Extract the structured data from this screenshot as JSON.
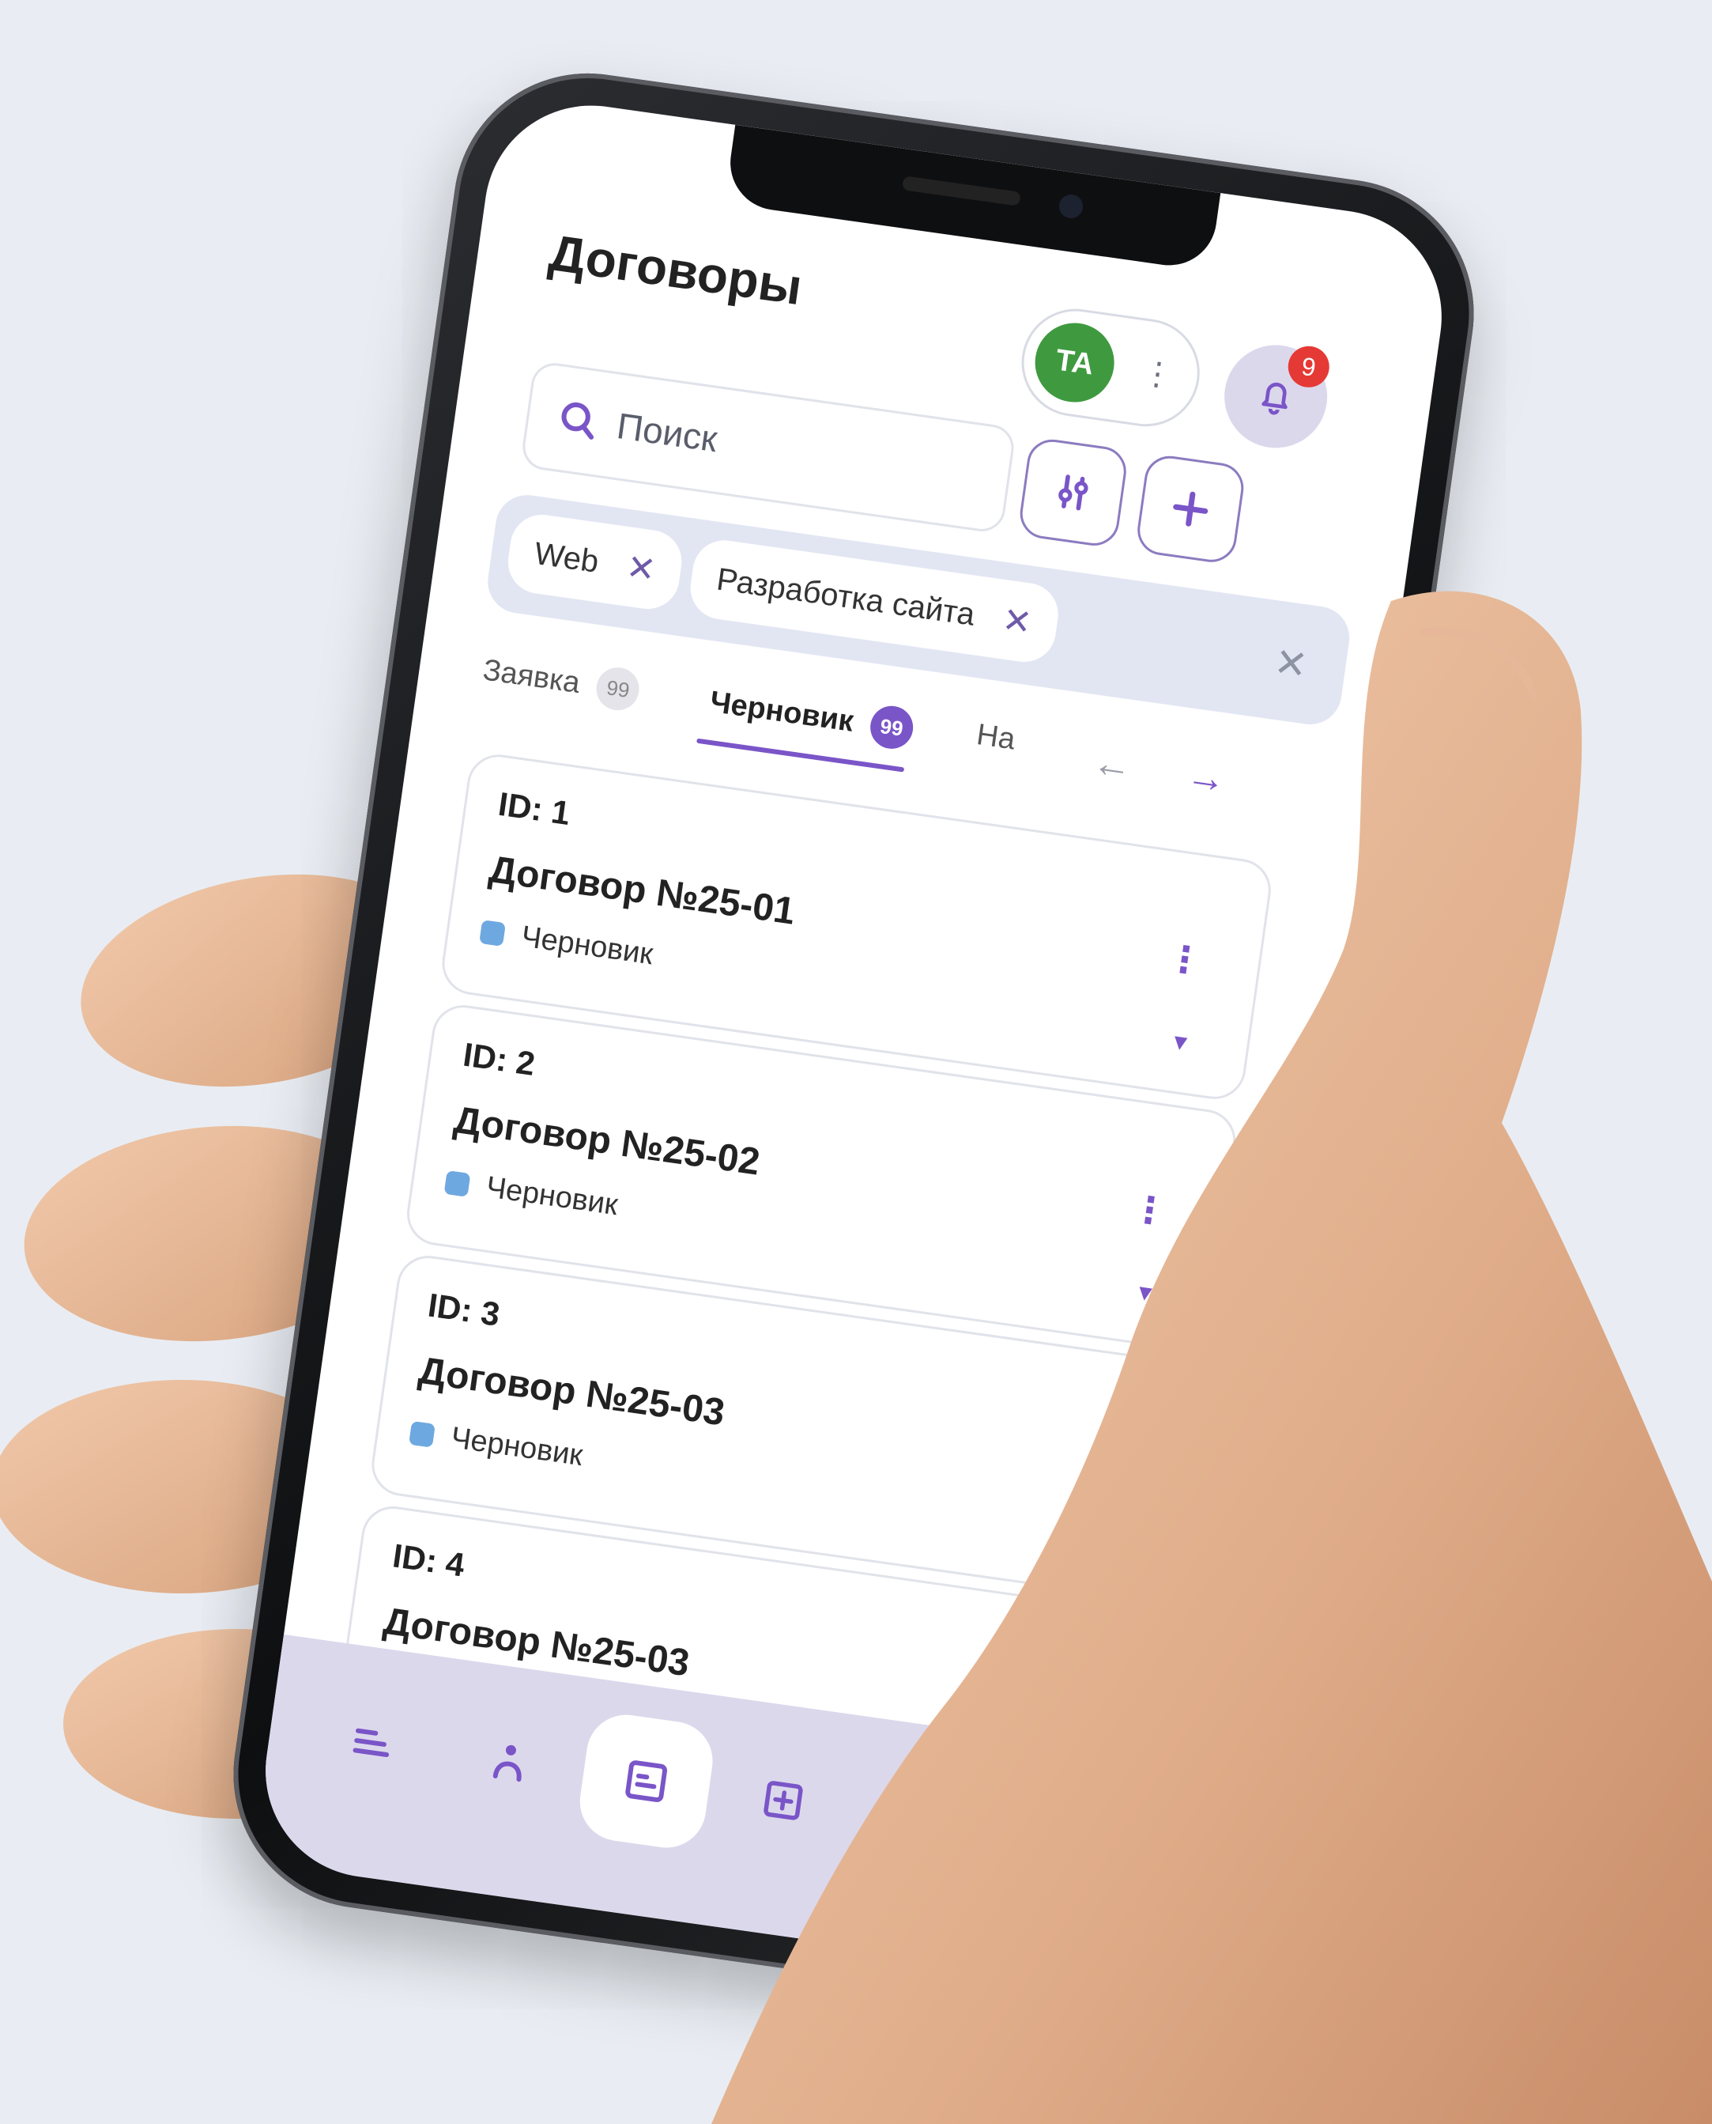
{
  "page": {
    "title": "Договоры"
  },
  "account": {
    "initials": "TA",
    "menu_glyph": "⋮",
    "avatar_color": "#3f9a3f"
  },
  "notifications": {
    "count": "9",
    "icon": "bell-icon"
  },
  "search": {
    "placeholder": "Поиск",
    "icon": "search-icon"
  },
  "toolbar": {
    "filter_icon": "filter-sliders-icon",
    "add_icon": "plus-icon"
  },
  "filters": {
    "chips": [
      {
        "label": "Web"
      },
      {
        "label": "Разработка сайта"
      }
    ],
    "remove_glyph": "✕",
    "clear_glyph": "✕"
  },
  "tabs": [
    {
      "label": "Заявка",
      "count": "99"
    },
    {
      "label": "Черновик",
      "count": "99"
    },
    {
      "label": "На",
      "count": ""
    }
  ],
  "tab_arrows": {
    "prev": "←",
    "next": "→"
  },
  "cards": [
    {
      "id": "ID: 1",
      "name": "Договор №25-01",
      "status": "Черновик"
    },
    {
      "id": "ID: 2",
      "name": "Договор №25-02",
      "status": "Черновик"
    },
    {
      "id": "ID: 3",
      "name": "Договор №25-03",
      "status": "Черновик"
    },
    {
      "id": "ID: 4",
      "name": "Договор №25-03",
      "status": ""
    }
  ],
  "card_glyphs": {
    "menu": "⋮",
    "expand": "▼"
  },
  "bottom_nav": [
    {
      "icon": "menu-lines-icon"
    },
    {
      "icon": "person-icon"
    },
    {
      "icon": "document-icon",
      "active": true
    },
    {
      "icon": "add-box-icon"
    },
    {
      "icon": "book-icon"
    }
  ],
  "colors": {
    "accent": "#7a55c8",
    "status_draft": "#6ea8e0",
    "badge": "#e53935",
    "nav_bg": "#dcd8ec"
  }
}
